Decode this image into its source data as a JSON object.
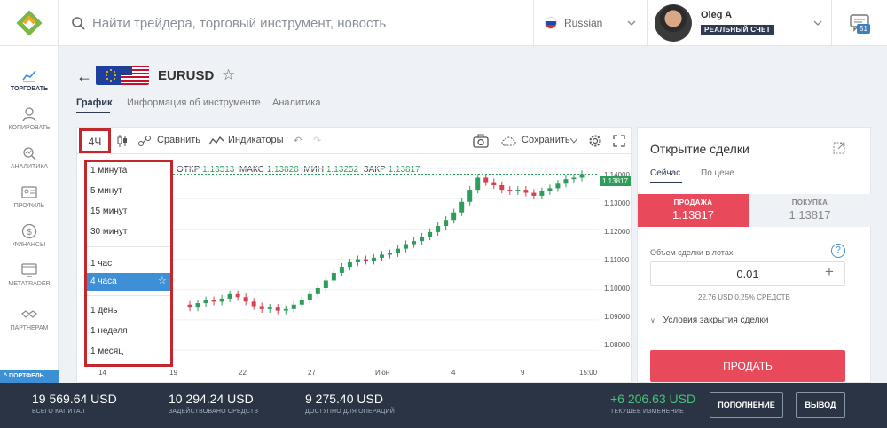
{
  "header": {
    "search_placeholder": "Найти трейдера, торговый инструмент, новость",
    "language": "Russian",
    "user_name": "Oleg A",
    "account_type": "РЕАЛЬНЫЙ СЧЕТ",
    "notifications_count": "51"
  },
  "sidebar": {
    "items": [
      {
        "label": "ТОРГОВАТЬ",
        "icon": "chart-icon"
      },
      {
        "label": "КОПИРОВАТЬ",
        "icon": "user-copy-icon"
      },
      {
        "label": "АНАЛИТИКА",
        "icon": "analytics-icon"
      },
      {
        "label": "ПРОФИЛЬ",
        "icon": "profile-icon"
      },
      {
        "label": "ФИНАНСЫ",
        "icon": "dollar-icon"
      },
      {
        "label": "METATRADER",
        "icon": "monitor-icon"
      },
      {
        "label": "ПАРТНЕРАМ",
        "icon": "handshake-icon"
      }
    ],
    "portfolio_tab": "ПОРТФЕЛЬ"
  },
  "instrument": {
    "symbol": "EURUSD",
    "tabs": [
      "График",
      "Информация об инструменте",
      "Аналитика"
    ]
  },
  "chart_toolbar": {
    "timeframe": "4Ч",
    "compare": "Сравнить",
    "indicators": "Индикаторы",
    "save": "Сохранить"
  },
  "timeframe_menu": {
    "items": [
      "1 минута",
      "5 минут",
      "15 минут",
      "30 минут",
      "1 час",
      "4 часа",
      "1 день",
      "1 неделя",
      "1 месяц"
    ],
    "selected": "4 часа"
  },
  "ohlc": {
    "open_label": "ОТКР",
    "open": "1.13513",
    "high_label": "МАКС",
    "high": "1.13828",
    "low_label": "МИН",
    "low": "1.13252",
    "close_label": "ЗАКР",
    "close": "1.13817"
  },
  "chart_data": {
    "type": "candlestick",
    "y_ticks": [
      "1.14000",
      "1.13000",
      "1.12000",
      "1.11000",
      "1.10000",
      "1.09000",
      "1.08000"
    ],
    "ylim": [
      1.075,
      1.143
    ],
    "x_ticks": [
      "14",
      "19",
      "22",
      "27",
      "Июн",
      "4",
      "9",
      "15:00"
    ],
    "last_price": "1.13817",
    "close_series": [
      1.095,
      1.094,
      1.0955,
      1.0965,
      1.096,
      1.097,
      1.0985,
      1.0975,
      1.096,
      1.0945,
      1.0935,
      1.094,
      1.093,
      1.0935,
      1.095,
      1.0965,
      1.0985,
      1.1005,
      1.103,
      1.1055,
      1.1075,
      1.109,
      1.11,
      1.1095,
      1.1105,
      1.1115,
      1.112,
      1.1135,
      1.115,
      1.116,
      1.1175,
      1.119,
      1.121,
      1.123,
      1.1255,
      1.129,
      1.133,
      1.137,
      1.1355,
      1.1345,
      1.133,
      1.1325,
      1.133,
      1.132,
      1.131,
      1.1325,
      1.1335,
      1.135,
      1.1365,
      1.137,
      1.1382
    ]
  },
  "order_panel": {
    "title": "Открытие сделки",
    "tabs": [
      "Сейчас",
      "По цене"
    ],
    "sell_label": "ПРОДАЖА",
    "sell_price": "1.13817",
    "buy_label": "ПОКУПКА",
    "buy_price": "1.13817",
    "lot_label": "Объем сделки в лотах",
    "lot_value": "0.01",
    "lot_meta": "22.76 USD   0.25% СРЕДСТВ",
    "close_conditions": "Условия закрытия сделки",
    "sell_button": "ПРОДАТЬ"
  },
  "footer": {
    "total_capital": "19 569.64 USD",
    "total_capital_label": "ВСЕГО КАПИТАЛ",
    "used_funds": "10 294.24 USD",
    "used_funds_label": "ЗАДЕЙСТВОВАНО СРЕДСТВ",
    "available": "9 275.40 USD",
    "available_label": "ДОСТУПНО ДЛЯ ОПЕРАЦИЙ",
    "current_change": "+6 206.63 USD",
    "current_change_label": "ТЕКУЩЕЕ ИЗМЕНЕНИЕ",
    "deposit_button": "ПОПОЛНЕНИЕ",
    "withdraw_button": "ВЫВОД"
  },
  "colors": {
    "up": "#2e9c5a",
    "down": "#d6404f",
    "accent": "#3d8fd6",
    "sell": "#e8495b",
    "footer_bg": "#2b3444"
  }
}
